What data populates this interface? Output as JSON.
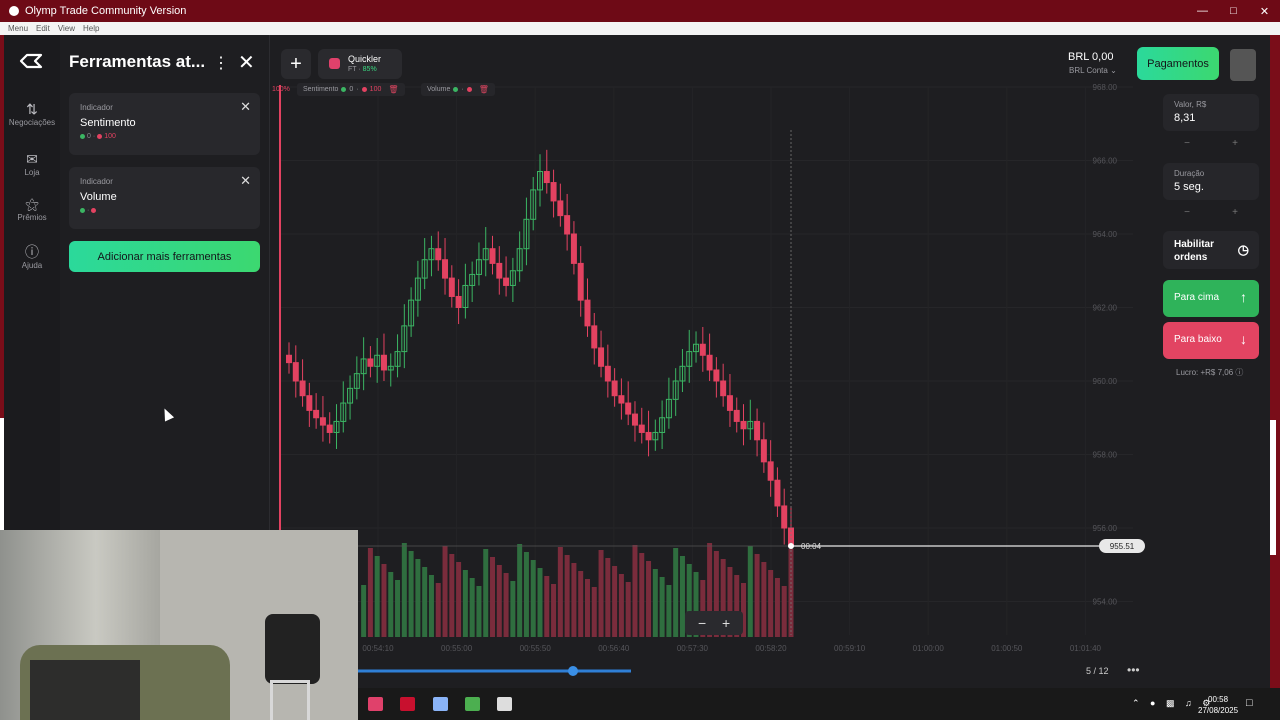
{
  "window": {
    "title": "Olymp Trade Community Version"
  },
  "menubar": [
    "Menu",
    "Edit",
    "View",
    "Help"
  ],
  "leftnav": [
    {
      "label": "Negociações",
      "icon": "swap-arrows-icon"
    },
    {
      "label": "Loja",
      "icon": "shop-bag-icon"
    },
    {
      "label": "Prêmios",
      "icon": "trophy-icon"
    },
    {
      "label": "Ajuda",
      "icon": "help-icon"
    }
  ],
  "panel": {
    "title": "Ferramentas at...",
    "cards": [
      {
        "label": "Indicador",
        "name": "Sentimento",
        "v1": "0",
        "v2": "100"
      },
      {
        "label": "Indicador",
        "name": "Volume"
      }
    ],
    "add_button": "Adicionar mais ferramentas"
  },
  "asset": {
    "name": "Quickler",
    "sub_prefix": "FT ·",
    "payout": "85%"
  },
  "indicator_chips": [
    {
      "name": "Sentimento",
      "v1": "0",
      "v2": "100"
    },
    {
      "name": "Volume"
    }
  ],
  "account": {
    "balance": "BRL 0,00",
    "sub": "BRL Conta",
    "pay_button": "Pagamentos"
  },
  "trade": {
    "amount_label": "Valor, R$",
    "amount_value": "8,31",
    "duration_label": "Duração",
    "duration_value": "5 seg.",
    "orders_label_1": "Habilitar",
    "orders_label_2": "ordens",
    "up_label": "Para cima",
    "down_label": "Para baixo",
    "profit": "Lucro: +R$ 7,06"
  },
  "chart_data": {
    "type": "candlestick",
    "price_ticks": [
      "968.00",
      "966.00",
      "964.00",
      "962.00",
      "960.00",
      "958.00",
      "956.00",
      "954.00"
    ],
    "time_ticks": [
      "00:54:10",
      "00:55:00",
      "00:55:50",
      "00:56:40",
      "00:57:30",
      "00:58:20",
      "00:59:10",
      "01:00:00",
      "01:00:50",
      "01:01:40"
    ],
    "current_price": "955.51",
    "countdown": "00:04",
    "top_marker": "100%",
    "page": "5 / 12",
    "colors": {
      "up": "#3bb563",
      "down": "#e34261",
      "bg": "#1e1e21"
    },
    "closes": [
      960.5,
      960.0,
      959.6,
      959.2,
      959.0,
      958.8,
      958.6,
      958.9,
      959.4,
      959.8,
      960.2,
      960.6,
      960.4,
      960.7,
      960.3,
      960.4,
      960.8,
      961.5,
      962.2,
      962.8,
      963.3,
      963.6,
      963.3,
      962.8,
      962.3,
      962.0,
      962.6,
      962.9,
      963.3,
      963.6,
      963.2,
      962.8,
      962.6,
      963.0,
      963.6,
      964.4,
      965.2,
      965.7,
      965.4,
      964.9,
      964.5,
      964.0,
      963.2,
      962.2,
      961.5,
      960.9,
      960.4,
      960.0,
      959.6,
      959.4,
      959.1,
      958.8,
      958.6,
      958.4,
      958.6,
      959.0,
      959.5,
      960.0,
      960.4,
      960.8,
      961.0,
      960.7,
      960.3,
      960.0,
      959.6,
      959.2,
      958.9,
      958.7,
      958.9,
      958.4,
      957.8,
      957.3,
      956.6,
      956.0,
      955.5
    ]
  },
  "taskbar": {
    "time": "00:58",
    "date": "27/08/2025"
  }
}
